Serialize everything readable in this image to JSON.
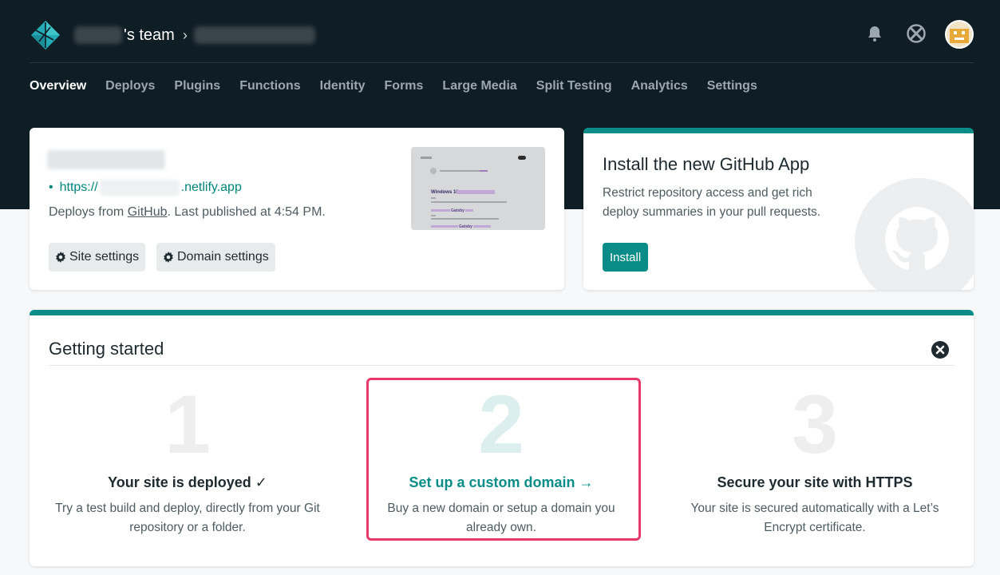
{
  "header": {
    "team_label": "'s team",
    "breadcrumb_separator": "›"
  },
  "nav": {
    "items": [
      {
        "label": "Overview",
        "active": true
      },
      {
        "label": "Deploys"
      },
      {
        "label": "Plugins"
      },
      {
        "label": "Functions"
      },
      {
        "label": "Identity"
      },
      {
        "label": "Forms"
      },
      {
        "label": "Large Media"
      },
      {
        "label": "Split Testing"
      },
      {
        "label": "Analytics"
      },
      {
        "label": "Settings"
      }
    ]
  },
  "site_card": {
    "url_prefix": "https://",
    "url_suffix": ".netlify.app",
    "deploys_from": "Deploys from",
    "deploy_source": "GitHub",
    "last_published": ". Last published at 4:54 PM.",
    "site_settings_label": "Site settings",
    "domain_settings_label": "Domain settings",
    "thumbnail": {
      "heading": "Windows 10",
      "link_1": "Gatsby",
      "link_2": "Gatsby"
    }
  },
  "github_card": {
    "title": "Install the new GitHub App",
    "description": "Restrict repository access and get rich deploy summaries in your pull requests.",
    "install_label": "Install"
  },
  "getting_started": {
    "title": "Getting started",
    "steps": [
      {
        "number": "1",
        "title": "Your site is deployed ✓",
        "description": "Try a test build and deploy, directly from your Git repository or a folder."
      },
      {
        "number": "2",
        "title": "Set up a custom domain →",
        "description": "Buy a new domain or setup a domain you already own."
      },
      {
        "number": "3",
        "title": "Secure your site with HTTPS",
        "description": "Your site is secured automatically with a Let’s Encrypt certificate."
      }
    ]
  },
  "colors": {
    "header_bg": "#0f1d24",
    "accent_teal": "#0a8d88",
    "highlight_pink": "#e8386a"
  }
}
